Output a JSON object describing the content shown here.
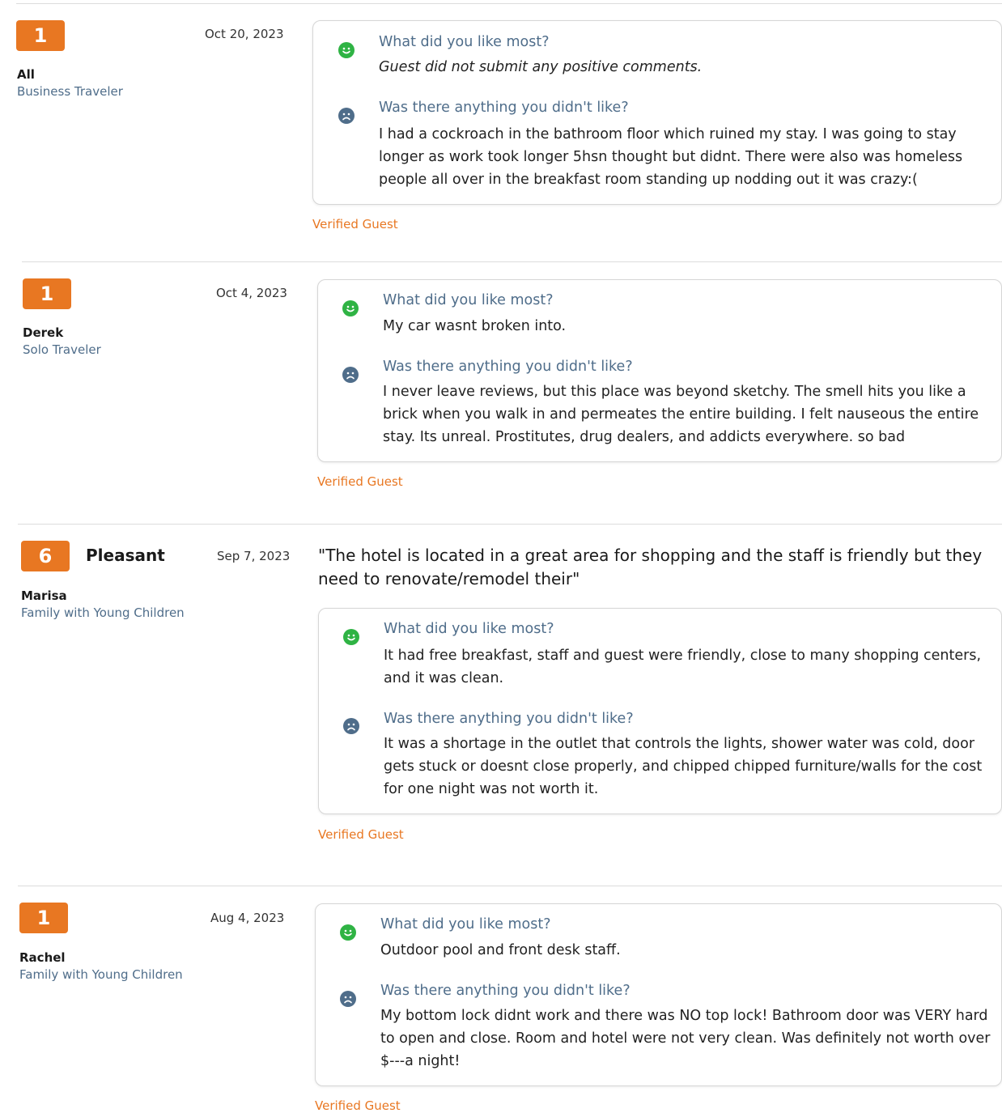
{
  "reviews": [
    {
      "score": "1",
      "score_word": "",
      "name": "All",
      "traveler_type": "Business Traveler",
      "date": "Oct 20, 2023",
      "headline": "",
      "liked_title": "What did you like most?",
      "liked_text": "Guest did not submit any positive comments.",
      "disliked_title": "Was there anything you didn't like?",
      "disliked_text": "I had a cockroach in the bathroom floor which ruined my stay. I was going to stay longer as work took longer 5hsn thought but didnt. There were also was homeless people all over in the breakfast room standing up nodding out it was crazy:(",
      "verified": "Verified Guest"
    },
    {
      "score": "1",
      "score_word": "",
      "name": "Derek",
      "traveler_type": "Solo Traveler",
      "date": "Oct 4, 2023",
      "headline": "",
      "liked_title": "What did you like most?",
      "liked_text": "My car wasnt broken into.",
      "disliked_title": "Was there anything you didn't like?",
      "disliked_text": "I never leave reviews, but this place was beyond sketchy. The smell hits you like a brick when you walk in and permeates the entire building. I felt nauseous the entire stay. Its unreal. Prostitutes, drug dealers, and addicts everywhere. so bad",
      "verified": "Verified Guest"
    },
    {
      "score": "6",
      "score_word": "Pleasant",
      "name": "Marisa",
      "traveler_type": "Family with Young Children",
      "date": "Sep 7, 2023",
      "headline": "\"The hotel is located in a great area for shopping and the staff is friendly but they need to renovate/remodel their\"",
      "liked_title": "What did you like most?",
      "liked_text": "It had free breakfast, staff and guest were friendly, close to many shopping centers, and it was clean.",
      "disliked_title": "Was there anything you didn't like?",
      "disliked_text": "It was a shortage in the outlet that controls the lights, shower water was cold, door gets stuck or doesnt close properly, and chipped chipped furniture/walls for the cost for one night was not worth it.",
      "verified": "Verified Guest"
    },
    {
      "score": "1",
      "score_word": "",
      "name": "Rachel",
      "traveler_type": "Family with Young Children",
      "date": "Aug 4, 2023",
      "headline": "",
      "liked_title": "What did you like most?",
      "liked_text": "Outdoor pool and front desk staff.",
      "disliked_title": "Was there anything you didn't like?",
      "disliked_text": "My bottom lock didnt work and there was NO top lock! Bathroom door was VERY hard to open and close. Room and hotel were not very clean. Was definitely not worth over $---a night!",
      "verified": "Verified Guest"
    }
  ],
  "colors": {
    "accent": "#e87722",
    "link_blue": "#4f6d8a",
    "happy": "#2fb344",
    "sad": "#4f6d8a"
  },
  "icons": {
    "liked": "smiley-happy-icon",
    "disliked": "smiley-sad-icon"
  }
}
